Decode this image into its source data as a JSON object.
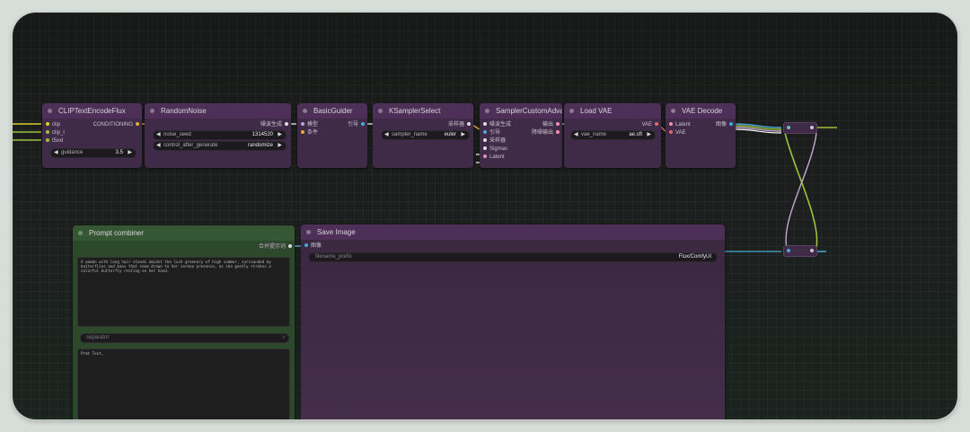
{
  "nodes": {
    "clip_text_encode": {
      "title": "CLIPTextEncodeFlux",
      "inputs": [
        "clip",
        "clip_l",
        "t5xxl"
      ],
      "output": "CONDITIONING",
      "widget": {
        "label": "guidance",
        "value": "3.5"
      }
    },
    "random_noise": {
      "title": "RandomNoise",
      "output": "噪波生成",
      "widgets": [
        {
          "label": "noise_seed",
          "value": "1314520"
        },
        {
          "label": "control_after_generate",
          "value": "randomize"
        }
      ]
    },
    "basic_guider": {
      "title": "BasicGuider",
      "inputs": [
        "模型",
        "条件"
      ],
      "output": "引导"
    },
    "ksampler_select": {
      "title": "KSamplerSelect",
      "output": "采样器",
      "widget": {
        "label": "sampler_name",
        "value": "euler"
      }
    },
    "sampler_custom_advanced": {
      "title": "SamplerCustomAdvanc",
      "inputs": [
        "噪波生成",
        "引导",
        "采样器",
        "Sigmas",
        "Latent"
      ],
      "outputs": [
        "输出",
        "降噪输出"
      ]
    },
    "load_vae": {
      "title": "Load VAE",
      "output": "VAE",
      "widget": {
        "label": "vae_name",
        "value": "ae.sft"
      }
    },
    "vae_decode": {
      "title": "VAE Decode",
      "inputs": [
        "Latent",
        "VAE"
      ],
      "output": "图像"
    },
    "prompt_combiner": {
      "title": "Prompt combiner",
      "output": "合并提示词",
      "text": "A woman with long hair stands amidst the lush greenery of high summer, surrounded by butterflies and baes that seem drawn to her serene presence, as she gently strokes a colorful butterfly resting on her hand.",
      "separator_placeholder": "separator",
      "text2": "Prmt Text,"
    },
    "save_image": {
      "title": "Save Image",
      "input": "图像",
      "widget": {
        "label": "filename_prefix",
        "value": "Flux/ComfyUI"
      }
    }
  },
  "colors": {
    "canvas": "#1c1e1d",
    "node_body": "#3f2a47",
    "node_title": "#4e2f58",
    "group_green": "#2c4a2b",
    "wire_yellow": "#d7d22e",
    "wire_green": "#9bc23c",
    "wire_blue": "#4aa8d6",
    "wire_pink": "#c6a7d0"
  }
}
